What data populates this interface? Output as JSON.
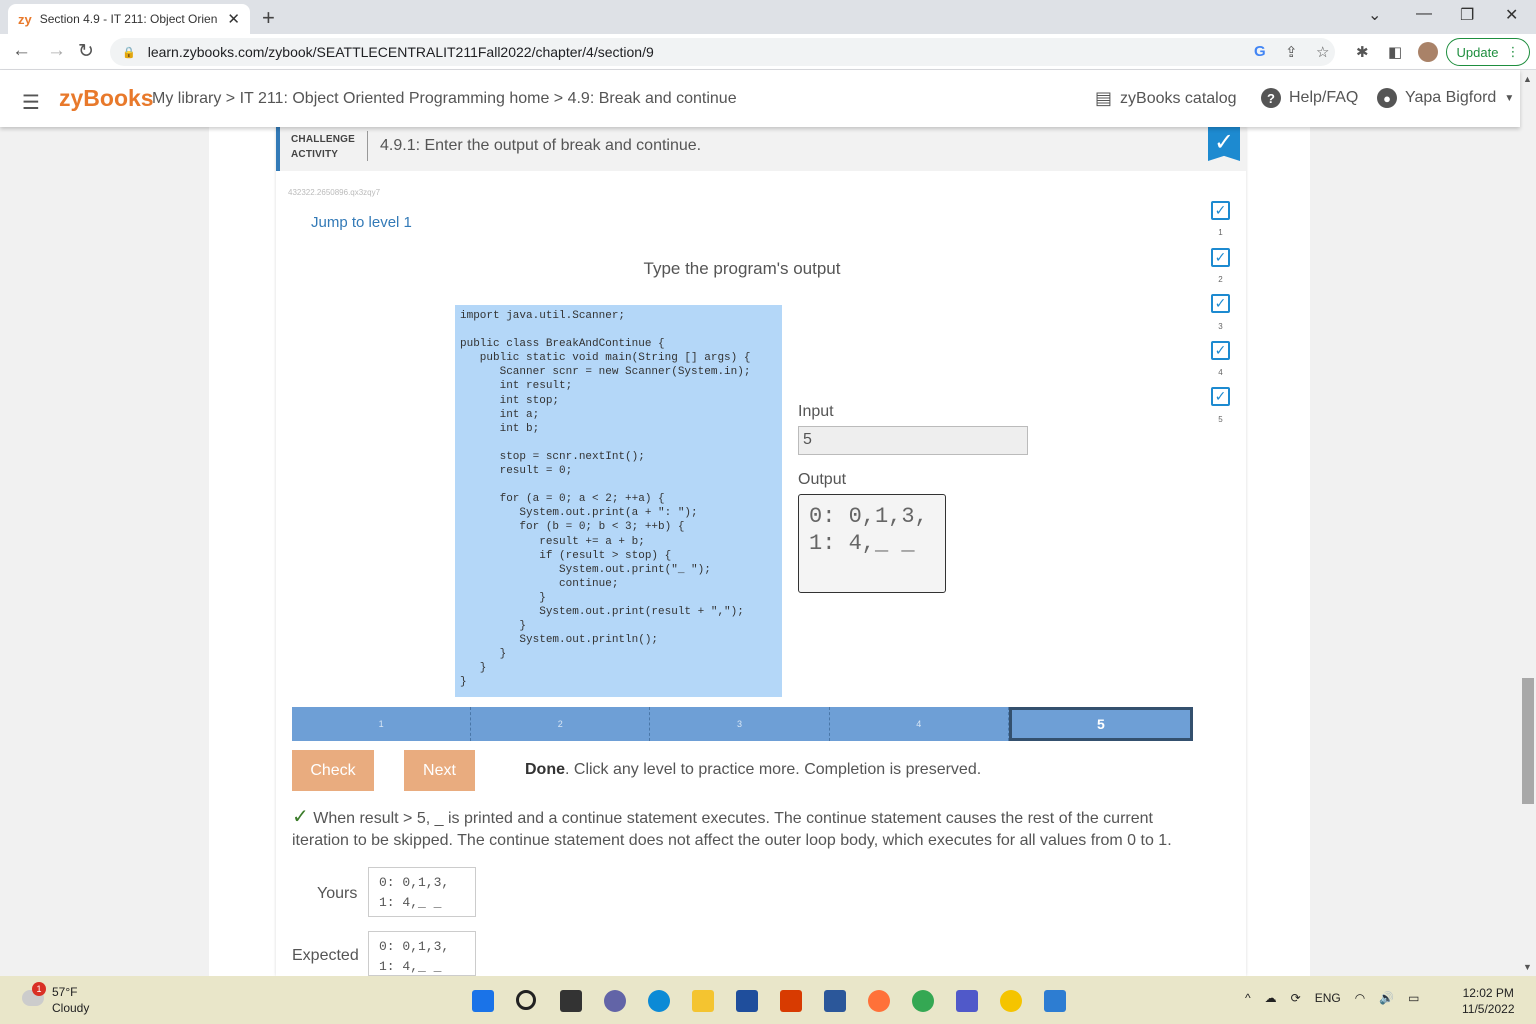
{
  "browser": {
    "tab_title": "Section 4.9 - IT 211: Object Orien",
    "tab_logo": "zy",
    "url": "learn.zybooks.com/zybook/SEATTLECENTRALIT211Fall2022/chapter/4/section/9",
    "update_label": "Update"
  },
  "header": {
    "logo": "zyBooks",
    "breadcrumb": "My library > IT 211: Object Oriented Programming home > 4.9: Break and continue",
    "catalog": "zyBooks catalog",
    "help": "Help/FAQ",
    "user": "Yapa Bigford"
  },
  "activity": {
    "type_label_1": "CHALLENGE",
    "type_label_2": "ACTIVITY",
    "title": "4.9.1: Enter the output of break and continue.",
    "id": "432322.2650896.qx3zqy7",
    "jump": "Jump to level 1",
    "prompt": "Type the program's output",
    "input_label": "Input",
    "input_value": "5",
    "output_label": "Output",
    "output_value": "0: 0,1,3,\n1: 4,_ _",
    "level_checks": [
      "1",
      "2",
      "3",
      "4",
      "5"
    ],
    "levels": [
      "1",
      "2",
      "3",
      "4",
      "5"
    ],
    "check_label": "Check",
    "next_label": "Next",
    "done_bold": "Done",
    "done_rest": ". Click any level to practice more. Completion is preserved.",
    "explanation": "When result > 5, _ is printed and a continue statement executes. The continue statement causes the rest of the current iteration to be skipped. The continue statement does not affect the outer loop body, which executes for all values from 0 to 1.",
    "yours_label": "Yours",
    "yours_value": "0: 0,1,3,\n1: 4,_ _",
    "expected_label": "Expected",
    "expected_value": "0: 0,1,3,\n1: 4,_ _"
  },
  "code": [
    "import java.util.Scanner;",
    "",
    "public class BreakAndContinue {",
    "   public static void main(String [] args) {",
    "      Scanner scnr = new Scanner(System.in);",
    "      int result;",
    "      int stop;",
    "      int a;",
    "      int b;",
    "",
    "      stop = scnr.nextInt();",
    "      result = 0;",
    "",
    "      for (a = 0; a < 2; ++a) {",
    "         System.out.print(a + \": \");",
    "         for (b = 0; b < 3; ++b) {",
    "            result += a + b;",
    "            if (result > stop) {",
    "               System.out.print(\"_ \");",
    "               continue;",
    "            }",
    "            System.out.print(result + \",\");",
    "         }",
    "         System.out.println();",
    "      }",
    "   }",
    "}"
  ],
  "taskbar": {
    "temp": "57°F",
    "condition": "Cloudy",
    "weather_badge": "1",
    "lang": "ENG",
    "time": "12:02 PM",
    "date": "11/5/2022"
  },
  "colors": {
    "accent": "#e8792b",
    "link": "#337ab7",
    "check_blue": "#1d8ad0",
    "code_bg": "#b4d7f8",
    "button": "#e9ac7f"
  }
}
